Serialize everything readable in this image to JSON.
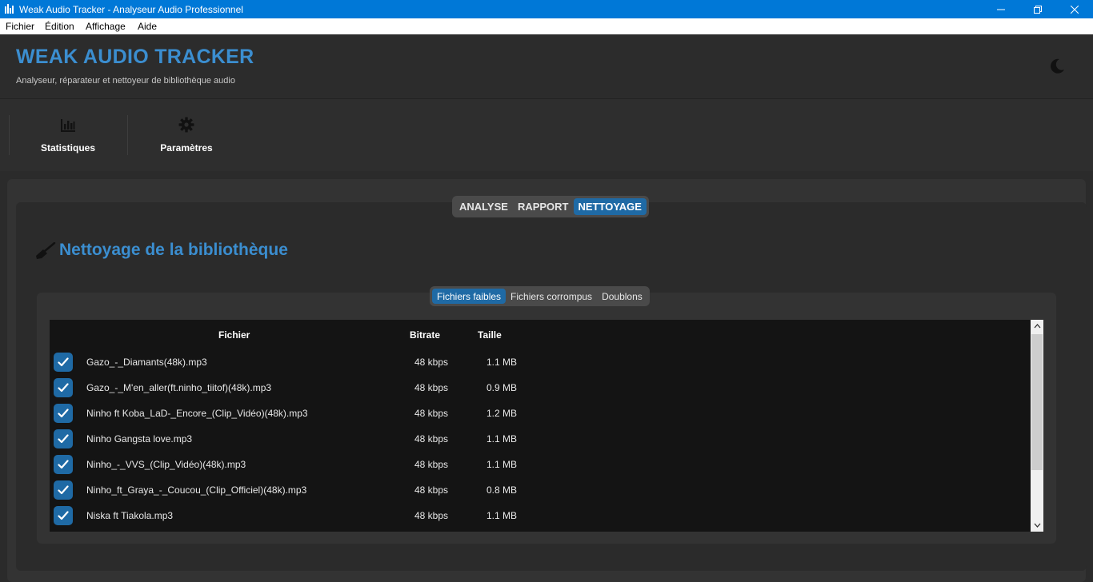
{
  "window": {
    "title": "Weak Audio Tracker - Analyseur Audio Professionnel"
  },
  "menu": [
    "Fichier",
    "Édition",
    "Affichage",
    "Aide"
  ],
  "header": {
    "title": "WEAK AUDIO TRACKER",
    "subtitle": "Analyseur, réparateur et nettoyeur de bibliothèque audio"
  },
  "toolbar": {
    "stats_label": "Statistiques",
    "settings_label": "Paramètres"
  },
  "main_tabs": [
    "ANALYSE",
    "RAPPORT",
    "NETTOYAGE"
  ],
  "section_title": "Nettoyage de la bibliothèque",
  "sub_tabs": [
    "Fichiers faibles",
    "Fichiers corrompus",
    "Doublons"
  ],
  "table": {
    "headers": {
      "file": "Fichier",
      "bitrate": "Bitrate",
      "size": "Taille"
    },
    "rows": [
      {
        "file": "Gazo_-_Diamants(48k).mp3",
        "bitrate": "48 kbps",
        "size": "1.1 MB",
        "checked": true
      },
      {
        "file": "Gazo_-_M'en_aller(ft.ninho_tiitof)(48k).mp3",
        "bitrate": "48 kbps",
        "size": "0.9 MB",
        "checked": true
      },
      {
        "file": "Ninho ft Koba_LaD-_Encore_(Clip_Vidéo)(48k).mp3",
        "bitrate": "48 kbps",
        "size": "1.2 MB",
        "checked": true
      },
      {
        "file": "Ninho Gangsta love.mp3",
        "bitrate": "48 kbps",
        "size": "1.1 MB",
        "checked": true
      },
      {
        "file": "Ninho_-_VVS_(Clip_Vidéo)(48k).mp3",
        "bitrate": "48 kbps",
        "size": "1.1 MB",
        "checked": true
      },
      {
        "file": "Ninho_ft_Graya_-_Coucou_(Clip_Officiel)(48k).mp3",
        "bitrate": "48 kbps",
        "size": "0.8 MB",
        "checked": true
      },
      {
        "file": "Niska ft Tiakola.mp3",
        "bitrate": "48 kbps",
        "size": "1.1 MB",
        "checked": true
      }
    ]
  },
  "colors": {
    "accent": "#3b8ed0",
    "selected": "#1f6aa5",
    "titlebar": "#0078d7"
  }
}
